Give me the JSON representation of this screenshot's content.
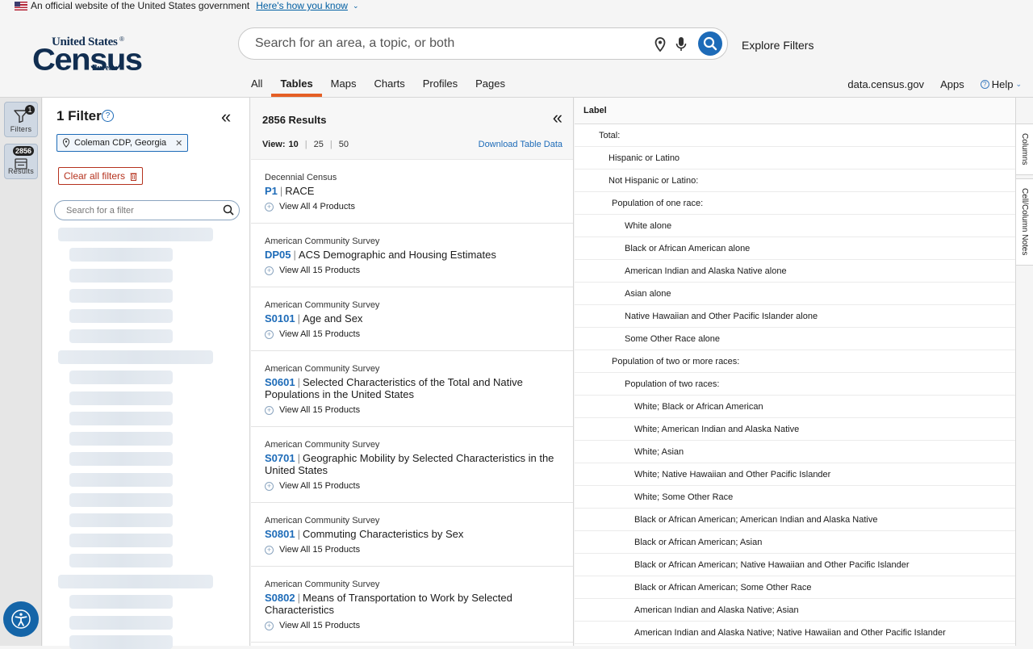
{
  "gov_banner": {
    "text": "An official website of the United States government",
    "link": "Here's how you know"
  },
  "logo": {
    "line1": "United States",
    "reg": "®",
    "line2": "Census",
    "line3": "Bureau"
  },
  "search": {
    "placeholder": "Search for an area, a topic, or both"
  },
  "header": {
    "explore_filters": "Explore Filters",
    "tabs": [
      "All",
      "Tables",
      "Maps",
      "Charts",
      "Profiles",
      "Pages"
    ],
    "active_tab": "Tables",
    "right_links": {
      "data_census": "data.census.gov",
      "apps": "Apps",
      "help": "Help"
    }
  },
  "rail": {
    "filters_label": "Filters",
    "filters_badge": "1",
    "results_label": "Results",
    "results_badge": "2856"
  },
  "filters": {
    "title": "1 Filter",
    "chip": "Coleman CDP, Georgia",
    "clear_all": "Clear all filters",
    "search_placeholder": "Search for a filter"
  },
  "results": {
    "count": "2856 Results",
    "view_label": "View:",
    "view_options": [
      "10",
      "25",
      "50"
    ],
    "download": "Download Table Data",
    "items": [
      {
        "survey": "Decennial Census",
        "code": "P1",
        "title": "RACE",
        "products": "View All 4 Products"
      },
      {
        "survey": "American Community Survey",
        "code": "DP05",
        "title": "ACS Demographic and Housing Estimates",
        "products": "View All 15 Products"
      },
      {
        "survey": "American Community Survey",
        "code": "S0101",
        "title": "Age and Sex",
        "products": "View All 15 Products"
      },
      {
        "survey": "American Community Survey",
        "code": "S0601",
        "title": "Selected Characteristics of the Total and Native Populations in the United States",
        "products": "View All 15 Products"
      },
      {
        "survey": "American Community Survey",
        "code": "S0701",
        "title": "Geographic Mobility by Selected Characteristics in the United States",
        "products": "View All 15 Products"
      },
      {
        "survey": "American Community Survey",
        "code": "S0801",
        "title": "Commuting Characteristics by Sex",
        "products": "View All 15 Products"
      },
      {
        "survey": "American Community Survey",
        "code": "S0802",
        "title": "Means of Transportation to Work by Selected Characteristics",
        "products": "View All 15 Products"
      }
    ]
  },
  "table": {
    "header": "Label",
    "rows": [
      {
        "label": "Total:",
        "level": 0
      },
      {
        "label": "Hispanic or Latino",
        "level": 1
      },
      {
        "label": "Not Hispanic or Latino:",
        "level": 1
      },
      {
        "label": "Population of one race:",
        "level": 2
      },
      {
        "label": "White alone",
        "level": 3
      },
      {
        "label": "Black or African American alone",
        "level": 3
      },
      {
        "label": "American Indian and Alaska Native alone",
        "level": 3
      },
      {
        "label": "Asian alone",
        "level": 3
      },
      {
        "label": "Native Hawaiian and Other Pacific Islander alone",
        "level": 3
      },
      {
        "label": "Some Other Race alone",
        "level": 3
      },
      {
        "label": "Population of two or more races:",
        "level": 2
      },
      {
        "label": "Population of two races:",
        "level": 3
      },
      {
        "label": "White; Black or African American",
        "level": 4
      },
      {
        "label": "White; American Indian and Alaska Native",
        "level": 4
      },
      {
        "label": "White; Asian",
        "level": 4
      },
      {
        "label": "White; Native Hawaiian and Other Pacific Islander",
        "level": 4
      },
      {
        "label": "White; Some Other Race",
        "level": 4
      },
      {
        "label": "Black or African American; American Indian and Alaska Native",
        "level": 4
      },
      {
        "label": "Black or African American; Asian",
        "level": 4
      },
      {
        "label": "Black or African American; Native Hawaiian and Other Pacific Islander",
        "level": 4
      },
      {
        "label": "Black or African American; Some Other Race",
        "level": 4
      },
      {
        "label": "American Indian and Alaska Native; Asian",
        "level": 4
      },
      {
        "label": "American Indian and Alaska Native; Native Hawaiian and Other Pacific Islander",
        "level": 4
      }
    ]
  },
  "side_tabs": {
    "columns": "Columns",
    "notes": "Cell/Column Notes"
  },
  "colors": {
    "accent": "#e55f25",
    "link": "#1d6bb8",
    "danger": "#b5321e",
    "brand_navy": "#112e51"
  }
}
